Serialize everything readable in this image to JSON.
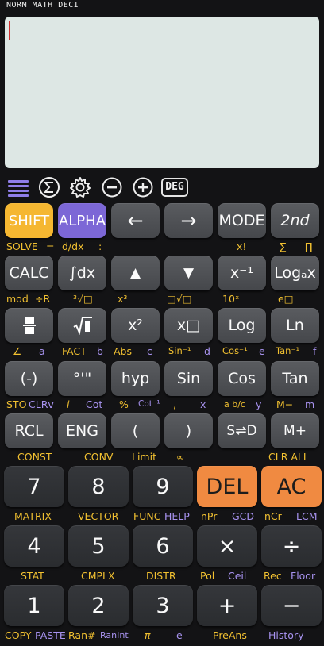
{
  "status": {
    "mode": "NORM MATH DECI"
  },
  "toolbar": {
    "icons": [
      "menu-icon",
      "sigma-icon",
      "gear-icon",
      "minus-circle-icon",
      "plus-circle-icon"
    ],
    "angle_mode": "DEG"
  },
  "keys": {
    "shift": "SHIFT",
    "alpha": "ALPHA",
    "left": "←",
    "right": "→",
    "mode": "MODE",
    "second": "2nd",
    "calc": "CALC",
    "integral": "∫dx",
    "up": "▲",
    "down": "▼",
    "inverse": "x⁻¹",
    "log_base": "Logₐx",
    "fraction": "",
    "sqrt": "√■",
    "square": "x²",
    "power": "x□",
    "log": "Log",
    "ln": "Ln",
    "negative": "(-)",
    "dms": "°'\"",
    "hyp": "hyp",
    "sin": "Sin",
    "cos": "Cos",
    "tan": "Tan",
    "rcl": "RCL",
    "eng": "ENG",
    "lparen": "(",
    "rparen": ")",
    "s_to_d": "S⇌D",
    "m_plus": "M+",
    "n7": "7",
    "n8": "8",
    "n9": "9",
    "del": "DEL",
    "ac": "AC",
    "n4": "4",
    "n5": "5",
    "n6": "6",
    "times": "×",
    "divide": "÷",
    "n1": "1",
    "n2": "2",
    "n3": "3",
    "plus": "+",
    "minus": "−"
  },
  "labels": {
    "r1": {
      "solve": "SOLVE",
      "eq": "=",
      "ddx": "d/dx",
      "colon": ":",
      "fact": "x!",
      "sum": "∑",
      "prod": "∏"
    },
    "r2": {
      "mod": "mod",
      "to_r": "÷R",
      "cbrt": "³√□",
      "cube": "x³",
      "xroot": "□√□",
      "ten": "10ˣ",
      "exp": "e□"
    },
    "r3": {
      "angle": "∠",
      "a": "a",
      "fact": "FACT",
      "b": "b",
      "abs": "Abs",
      "c": "c",
      "asin": "Sin⁻¹",
      "d": "d",
      "acos": "Cos⁻¹",
      "e": "e",
      "atan": "Tan⁻¹",
      "f": "f"
    },
    "r4": {
      "sto": "STO",
      "clrv": "CLRv",
      "i": "i",
      "cot": "Cot",
      "pct": "%",
      "acot": "Cot⁻¹",
      "comma": ",",
      "x": "x",
      "abc": "a b/c",
      "y": "y",
      "mminus": "M−",
      "m": "m"
    },
    "r5": {
      "const": "CONST",
      "conv": "CONV",
      "limit": "Limit",
      "inf": "∞",
      "clr_all": "CLR ALL"
    },
    "r6": {
      "matrix": "MATRIX",
      "vector": "VECTOR",
      "func": "FUNC",
      "help": "HELP",
      "npr": "nPr",
      "gcd": "GCD",
      "ncr": "nCr",
      "lcm": "LCM"
    },
    "r7": {
      "stat": "STAT",
      "cmplx": "CMPLX",
      "distr": "DISTR",
      "pol": "Pol",
      "ceil": "Ceil",
      "rec": "Rec",
      "floor": "Floor"
    },
    "r8": {
      "copy": "COPY",
      "paste": "PASTE",
      "ran": "Ran#",
      "ranint": "RanInt",
      "pi": "π",
      "e": "e",
      "preans": "PreAns",
      "history": "History"
    }
  },
  "colors": {
    "shift": "#f5b731",
    "alpha": "#7c67d6",
    "orange": "#f08a41",
    "display": "#dde7e4",
    "label_yellow": "#f2c131",
    "label_purple": "#a893f0"
  }
}
